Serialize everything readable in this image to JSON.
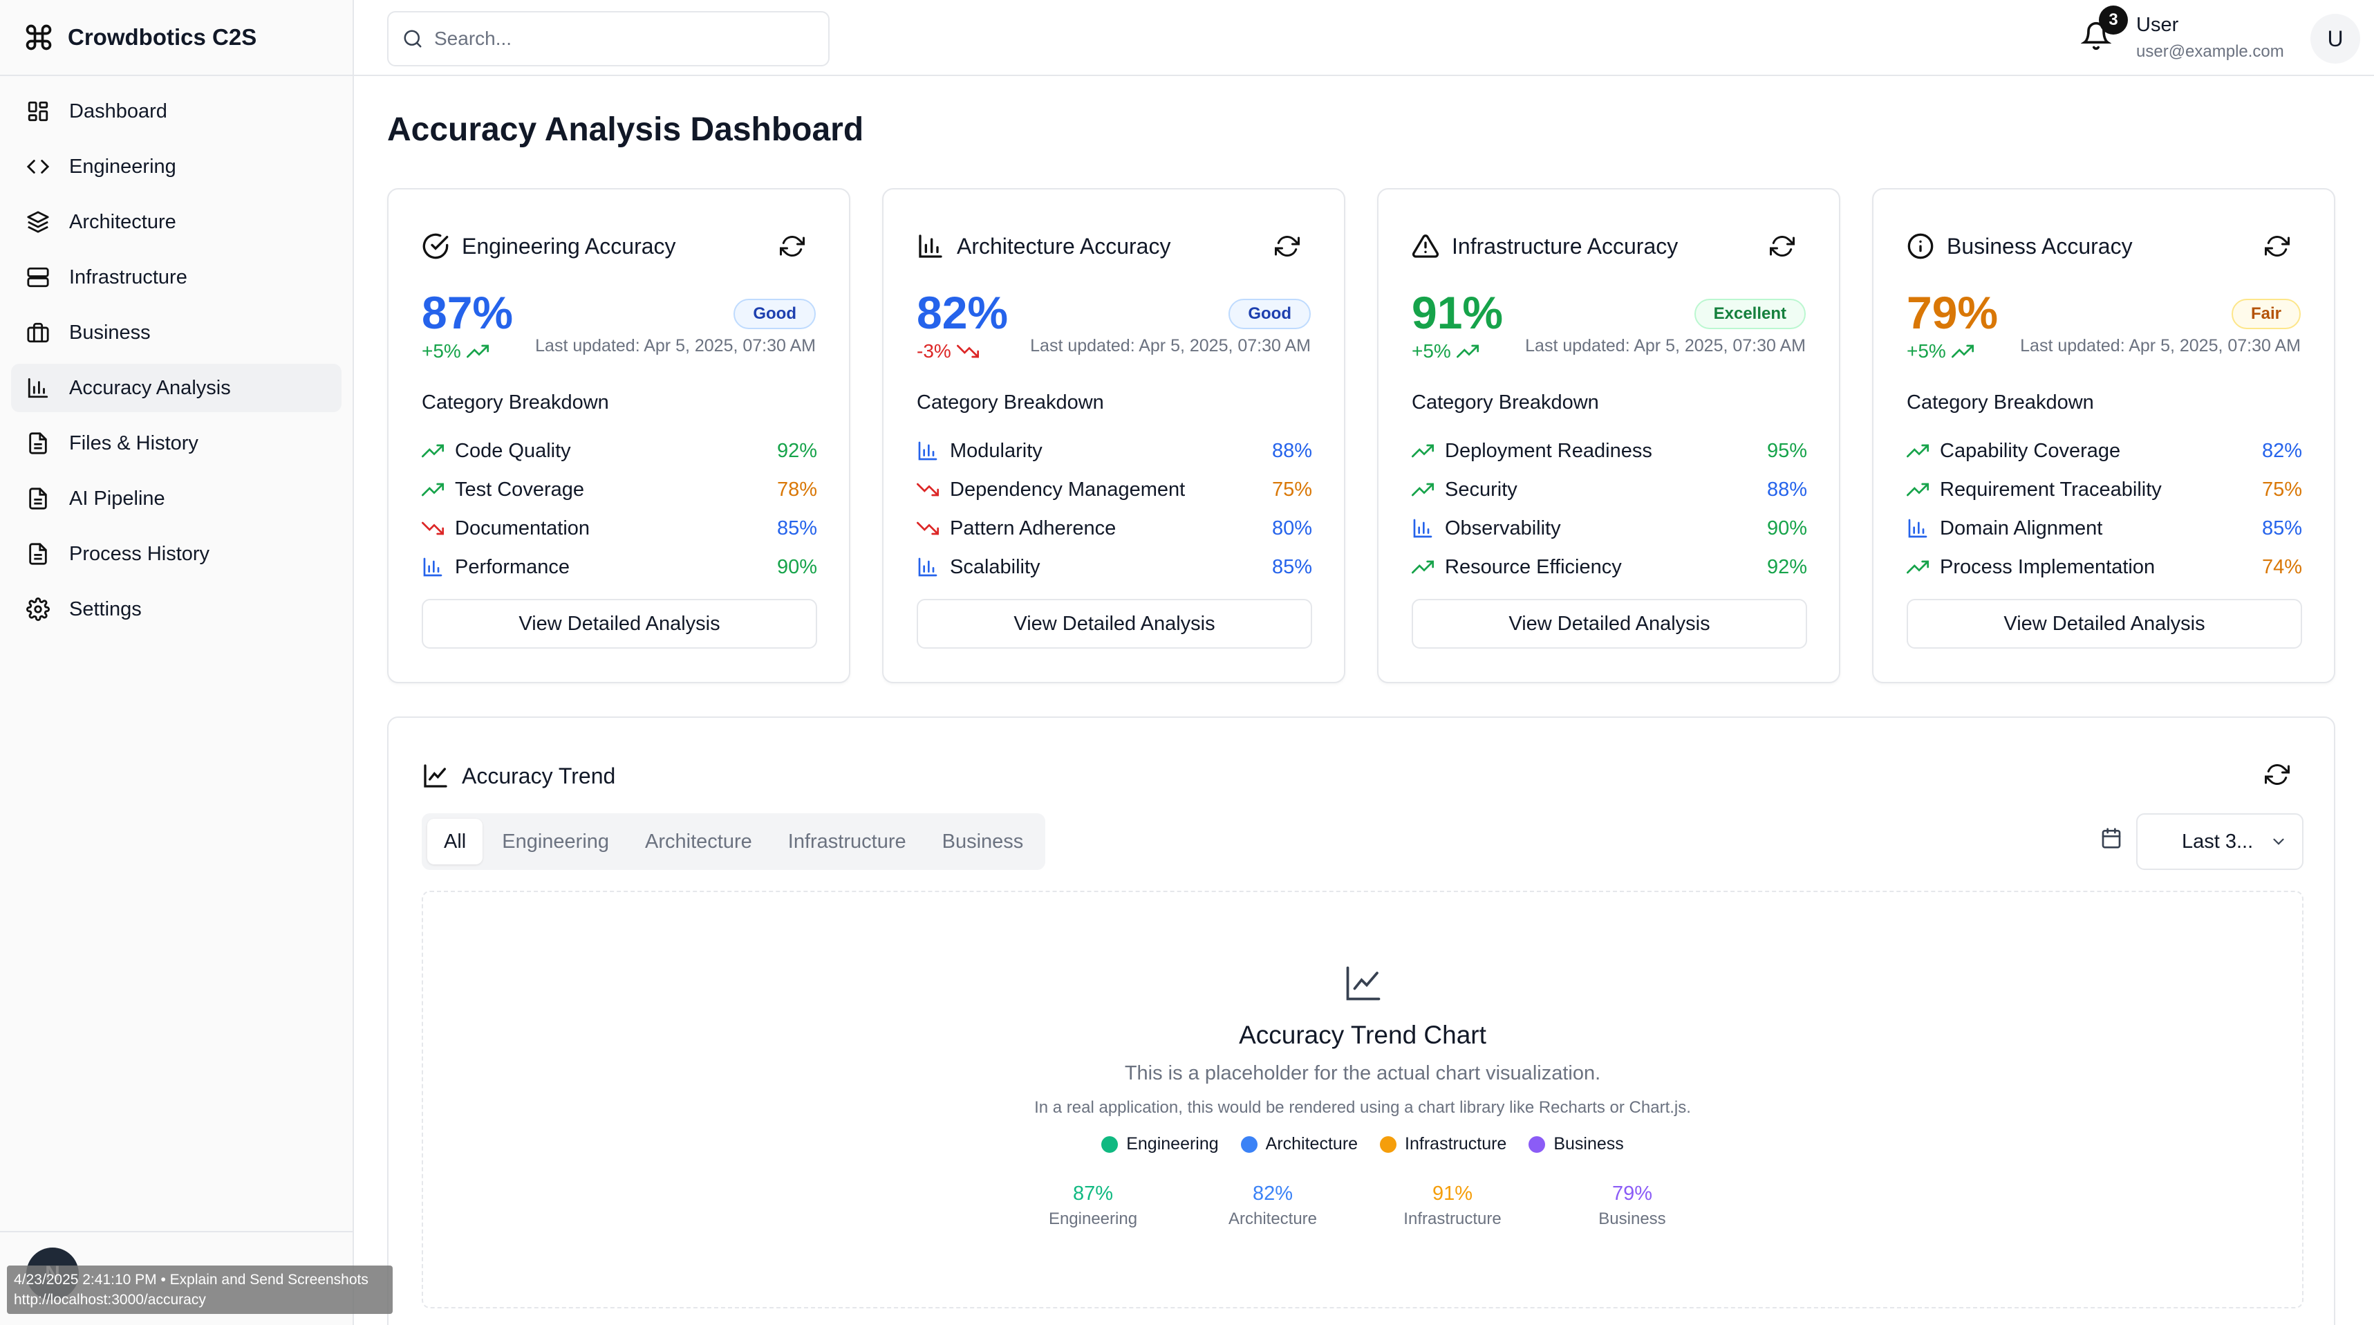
{
  "app": {
    "name": "Crowdbotics C2S"
  },
  "sidebar": {
    "items": [
      {
        "label": "Dashboard",
        "icon": "dashboard-icon"
      },
      {
        "label": "Engineering",
        "icon": "code-icon"
      },
      {
        "label": "Architecture",
        "icon": "layers-icon"
      },
      {
        "label": "Infrastructure",
        "icon": "server-icon"
      },
      {
        "label": "Business",
        "icon": "briefcase-icon"
      },
      {
        "label": "Accuracy Analysis",
        "icon": "bar-chart-icon",
        "active": true
      },
      {
        "label": "Files & History",
        "icon": "file-icon"
      },
      {
        "label": "AI Pipeline",
        "icon": "file-icon"
      },
      {
        "label": "Process History",
        "icon": "file-icon"
      },
      {
        "label": "Settings",
        "icon": "gear-icon"
      }
    ],
    "footer_avatar": "N"
  },
  "overlay": {
    "line1": "4/23/2025 2:41:10 PM • Explain and Send Screenshots",
    "line2": "http://localhost:3000/accuracy"
  },
  "header": {
    "search_placeholder": "Search...",
    "notifications_count": "3",
    "user_name": "User",
    "user_email": "user@example.com",
    "user_initial": "U"
  },
  "page": {
    "title": "Accuracy Analysis Dashboard"
  },
  "cards": [
    {
      "title": "Engineering Accuracy",
      "icon": "check-circle-icon",
      "value": "87%",
      "status": "Good",
      "delta": "+5%",
      "updated": "Last updated: Apr 5, 2025, 07:30 AM",
      "breakdown_title": "Category Breakdown",
      "rows": [
        {
          "label": "Code Quality",
          "value": "92%",
          "trend": "up"
        },
        {
          "label": "Test Coverage",
          "value": "78%",
          "trend": "up"
        },
        {
          "label": "Documentation",
          "value": "85%",
          "trend": "down"
        },
        {
          "label": "Performance",
          "value": "90%",
          "trend": "flat"
        }
      ],
      "button": "View Detailed Analysis"
    },
    {
      "title": "Architecture Accuracy",
      "icon": "bar-chart-icon",
      "value": "82%",
      "status": "Good",
      "delta": "-3%",
      "updated": "Last updated: Apr 5, 2025, 07:30 AM",
      "breakdown_title": "Category Breakdown",
      "rows": [
        {
          "label": "Modularity",
          "value": "88%",
          "trend": "flat"
        },
        {
          "label": "Dependency Management",
          "value": "75%",
          "trend": "down"
        },
        {
          "label": "Pattern Adherence",
          "value": "80%",
          "trend": "down"
        },
        {
          "label": "Scalability",
          "value": "85%",
          "trend": "flat"
        }
      ],
      "button": "View Detailed Analysis"
    },
    {
      "title": "Infrastructure Accuracy",
      "icon": "alert-triangle-icon",
      "value": "91%",
      "status": "Excellent",
      "delta": "+5%",
      "updated": "Last updated: Apr 5, 2025, 07:30 AM",
      "breakdown_title": "Category Breakdown",
      "rows": [
        {
          "label": "Deployment Readiness",
          "value": "95%",
          "trend": "up"
        },
        {
          "label": "Security",
          "value": "88%",
          "trend": "up"
        },
        {
          "label": "Observability",
          "value": "90%",
          "trend": "flat"
        },
        {
          "label": "Resource Efficiency",
          "value": "92%",
          "trend": "up"
        }
      ],
      "button": "View Detailed Analysis"
    },
    {
      "title": "Business Accuracy",
      "icon": "info-icon",
      "value": "79%",
      "status": "Fair",
      "delta": "+5%",
      "updated": "Last updated: Apr 5, 2025, 07:30 AM",
      "breakdown_title": "Category Breakdown",
      "rows": [
        {
          "label": "Capability Coverage",
          "value": "82%",
          "trend": "up"
        },
        {
          "label": "Requirement Traceability",
          "value": "75%",
          "trend": "up"
        },
        {
          "label": "Domain Alignment",
          "value": "85%",
          "trend": "flat"
        },
        {
          "label": "Process Implementation",
          "value": "74%",
          "trend": "up"
        }
      ],
      "button": "View Detailed Analysis"
    }
  ],
  "trend": {
    "title": "Accuracy Trend",
    "tabs": [
      "All",
      "Engineering",
      "Architecture",
      "Infrastructure",
      "Business"
    ],
    "active_tab": "All",
    "range": "Last 3...",
    "placeholder_title": "Accuracy Trend Chart",
    "placeholder_sub": "This is a placeholder for the actual chart visualization.",
    "placeholder_note": "In a real application, this would be rendered using a chart library like Recharts or Chart.js.",
    "legend": [
      {
        "label": "Engineering",
        "color": "#10b981"
      },
      {
        "label": "Architecture",
        "color": "#3b82f6"
      },
      {
        "label": "Infrastructure",
        "color": "#f59e0b"
      },
      {
        "label": "Business",
        "color": "#8b5cf6"
      }
    ],
    "summary": [
      {
        "value": "87%",
        "label": "Engineering",
        "color": "#10b981"
      },
      {
        "value": "82%",
        "label": "Architecture",
        "color": "#3b82f6"
      },
      {
        "value": "91%",
        "label": "Infrastructure",
        "color": "#f59e0b"
      },
      {
        "value": "79%",
        "label": "Business",
        "color": "#8b5cf6"
      }
    ]
  },
  "colors": {
    "good": "#2563eb",
    "excellent": "#16a34a",
    "fair": "#d97706",
    "up": "#16a34a",
    "down": "#dc2626",
    "flat": "#2563eb"
  }
}
